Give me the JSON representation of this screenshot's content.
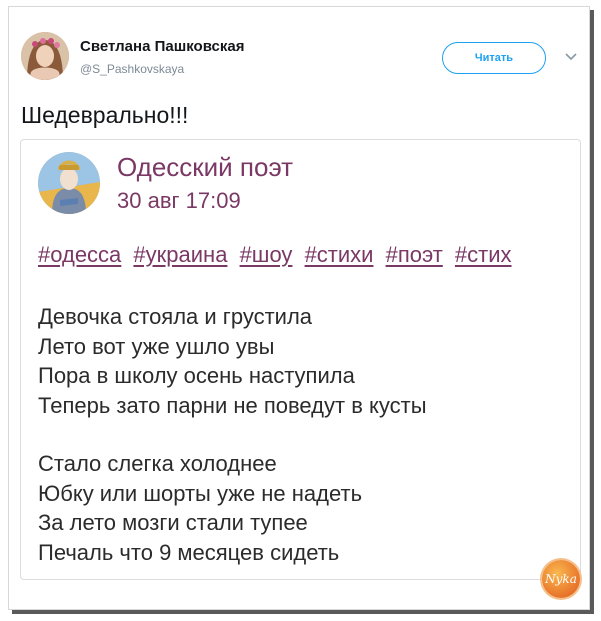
{
  "tweet": {
    "display_name": "Светлана Пашковская",
    "handle": "@S_Pashkovskaya",
    "follow_label": "Читать",
    "text": "Шедеврально!!!"
  },
  "card": {
    "author": "Одесский поэт",
    "date": "30 авг 17:09",
    "hashtags": [
      "#одесса",
      "#украина",
      "#шоу",
      "#стихи",
      "#поэт",
      "#стих"
    ],
    "poem": {
      "stanza1": [
        "Девочка стояла и грустила",
        "Лето вот уже ушло увы",
        "Пора в школу осень наступила",
        "Теперь зато парни не поведут в кусты"
      ],
      "stanza2": [
        "Стало слегка холоднее",
        "Юбку или шорты уже не надеть",
        "За лето мозги стали тупее",
        "Печаль что 9 месяцев сидеть"
      ]
    }
  },
  "watermark": {
    "text": "Nyka"
  },
  "colors": {
    "accent": "#1da1f2",
    "card_text": "#7a3864",
    "poem_text": "#2b2b2b",
    "frame_shadow": "#5a5a5a"
  }
}
